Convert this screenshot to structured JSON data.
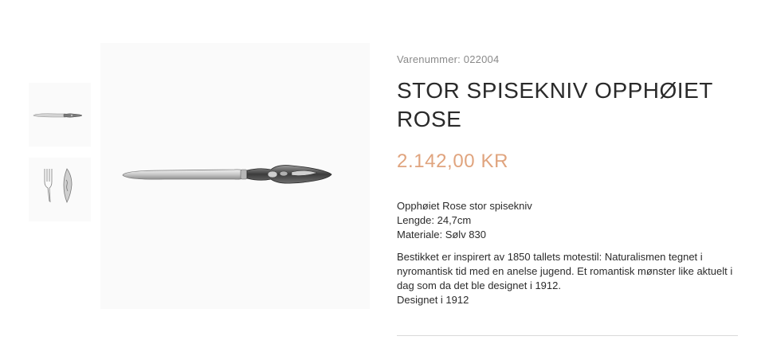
{
  "product": {
    "sku_label": "Varenummer:",
    "sku_value": "022004",
    "title": "STOR SPISEKNIV OPPHØIET ROSE",
    "price": "2.142,00 KR",
    "specs": [
      "Opphøiet Rose stor spisekniv",
      "Lengde: 24,7cm",
      "Materiale: Sølv 830"
    ],
    "description": [
      "Bestikket er inspirert av 1850 tallets motestil: Naturalismen tegnet i nyromantisk tid med en anelse jugend. Et romantisk mønster like aktuelt i dag som da det ble designet i 1912.",
      "Designet i 1912"
    ]
  },
  "gallery": {
    "thumbnails": [
      {
        "icon": "knife-thumbnail"
      },
      {
        "icon": "fork-and-spoon-thumbnail"
      }
    ],
    "main": {
      "icon": "knife-image"
    }
  },
  "colors": {
    "price": "#e0a47e",
    "text": "#2b2b2b",
    "muted": "#8a8a8a",
    "image_bg": "#fafafa"
  }
}
